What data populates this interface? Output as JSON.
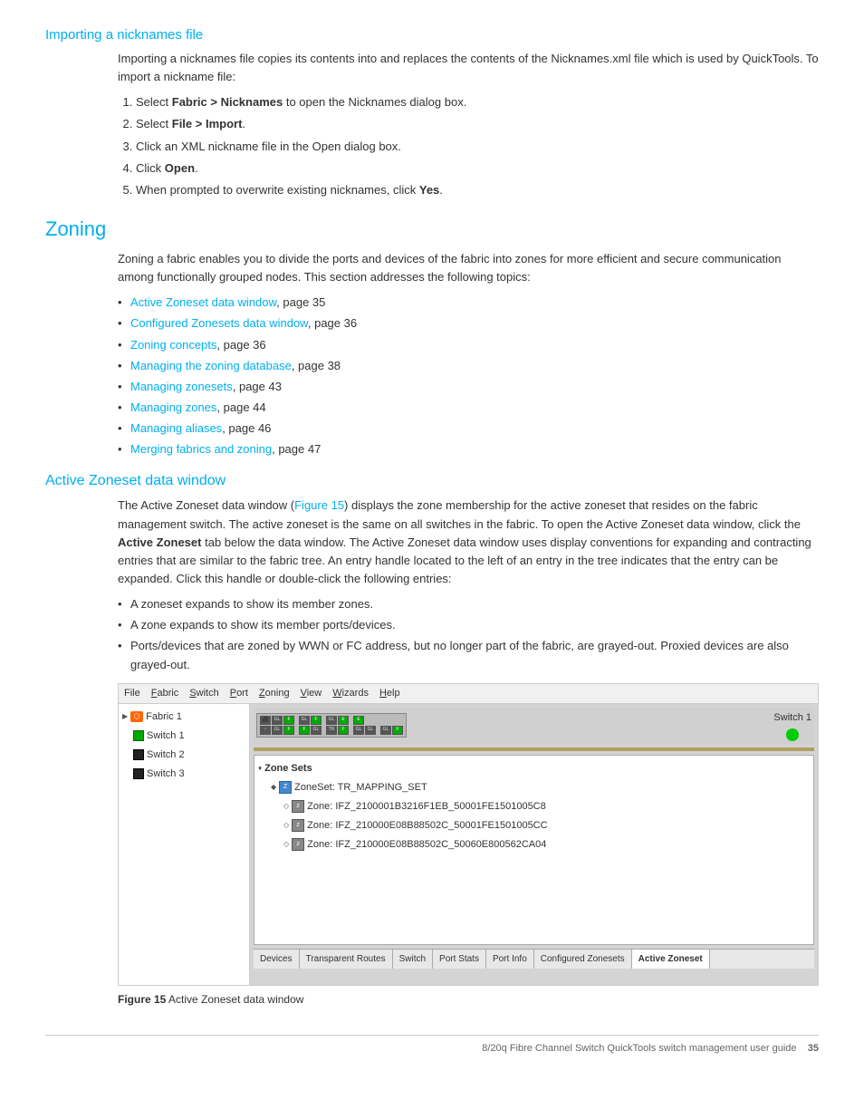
{
  "page": {
    "importing_heading": "Importing a nicknames file",
    "importing_intro": "Importing a nicknames file copies its contents into and replaces the contents of the Nicknames.xml file which is used by QuickTools. To import a nickname file:",
    "importing_steps": [
      {
        "num": "1.",
        "text": "Select ",
        "bold": "Fabric > Nicknames",
        "rest": " to open the Nicknames dialog box."
      },
      {
        "num": "2.",
        "text": "Select ",
        "bold": "File > Import",
        "rest": "."
      },
      {
        "num": "3.",
        "text": "Click an XML nickname file in the Open dialog box.",
        "bold": "",
        "rest": ""
      },
      {
        "num": "4.",
        "text": "Click ",
        "bold": "Open",
        "rest": "."
      },
      {
        "num": "5.",
        "text": "When prompted to overwrite existing nicknames, click ",
        "bold": "Yes",
        "rest": "."
      }
    ],
    "zoning_heading": "Zoning",
    "zoning_intro": "Zoning a fabric enables you to divide the ports and devices of the fabric into zones for more efficient and secure communication among functionally grouped nodes. This section addresses the following topics:",
    "zoning_links": [
      {
        "link": "Active Zoneset data window",
        "page": ", page 35"
      },
      {
        "link": "Configured Zonesets data window",
        "page": ", page 36"
      },
      {
        "link": "Zoning concepts",
        "page": ", page 36"
      },
      {
        "link": "Managing the zoning database",
        "page": ", page 38"
      },
      {
        "link": "Managing zonesets",
        "page": ", page 43"
      },
      {
        "link": "Managing zones",
        "page": ", page 44"
      },
      {
        "link": "Managing aliases",
        "page": ", page 46"
      },
      {
        "link": "Merging fabrics and zoning",
        "page": ", page 47"
      }
    ],
    "active_zoneset_heading": "Active Zoneset data window",
    "active_zoneset_para": "The Active Zoneset data window (Figure 15) displays the zone membership for the active zoneset that resides on the fabric management switch. The active zoneset is the same on all switches in the fabric. To open the Active Zoneset data window, click the Active Zoneset tab below the data window. The Active Zoneset data window uses display conventions for expanding and contracting entries that are similar to the fabric tree. An entry handle located to the left of an entry in the tree indicates that the entry can be expanded. Click this handle or double-click the following entries:",
    "active_zoneset_para_bold": "Active Zoneset",
    "active_zoneset_bullets": [
      "A zoneset expands to show its member zones.",
      "A zone expands to show its member ports/devices.",
      "Ports/devices that are zoned by WWN or FC address, but no longer part of the fabric, are grayed-out. Proxied devices are also grayed-out."
    ],
    "figure": {
      "menubar": [
        "File",
        "Fabric",
        "Switch",
        "Port",
        "Zoning",
        "View",
        "Wizards",
        "Help"
      ],
      "left_tree": {
        "items": [
          {
            "label": "Fabric 1",
            "type": "fabric",
            "indent": 0
          },
          {
            "label": "Switch 1",
            "type": "switch-green",
            "indent": 1
          },
          {
            "label": "Switch 2",
            "type": "switch-black",
            "indent": 1
          },
          {
            "label": "Switch 3",
            "type": "switch-black",
            "indent": 1
          }
        ]
      },
      "switch_label": "Switch 1",
      "zone_sets_label": "Zone Sets",
      "zone_items": [
        {
          "label": "ZoneSet: TR_MAPPING_SET",
          "type": "zoneset",
          "indent": 0
        },
        {
          "label": "Zone: IFZ_2100001B3216F1EB_50001FE1501005C8",
          "indent": 1
        },
        {
          "label": "Zone: IFZ_210000E08B88502C_50001FE1501005CC",
          "indent": 1
        },
        {
          "label": "Zone: IFZ_210000E08B88502C_50060E800562CA04",
          "indent": 1
        }
      ],
      "tabs": [
        {
          "label": "Devices",
          "active": false
        },
        {
          "label": "Transparent Routes",
          "active": false
        },
        {
          "label": "Switch",
          "active": false
        },
        {
          "label": "Port Stats",
          "active": false
        },
        {
          "label": "Port Info",
          "active": false
        },
        {
          "label": "Configured Zonesets",
          "active": false
        },
        {
          "label": "Active Zoneset",
          "active": true
        }
      ]
    },
    "figure_caption": "Figure 15",
    "figure_caption_text": " Active Zoneset data window",
    "footer_text": "8/20q Fibre Channel Switch QuickTools switch management user guide",
    "footer_page": "35"
  }
}
